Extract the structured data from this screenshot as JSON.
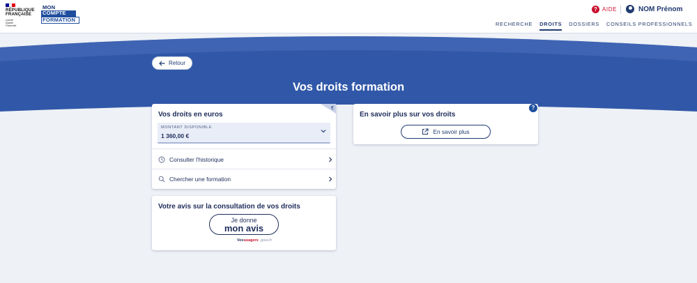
{
  "header": {
    "republique": [
      "RÉPUBLIQUE",
      "FRANÇAISE"
    ],
    "motto": [
      "Liberté",
      "Égalité",
      "Fraternité"
    ],
    "mcf": [
      "MON",
      "COMPTE",
      "FORMATION"
    ],
    "help_label": "AIDE",
    "user_name": "NOM Prénom",
    "nav": [
      {
        "label": "RECHERCHE",
        "active": false
      },
      {
        "label": "DROITS",
        "active": true
      },
      {
        "label": "DOSSIERS",
        "active": false
      },
      {
        "label": "CONSEILS PROFESSIONNELS",
        "active": false
      }
    ]
  },
  "banner": {
    "back_label": "Retour",
    "title": "Vos droits formation"
  },
  "rights_card": {
    "title": "Vos droits en euros",
    "amount_label": "MONTANT DISPONIBLE",
    "amount_value": "1 360,00 €",
    "links": [
      {
        "label": "Consulter l'historique",
        "icon": "history-icon"
      },
      {
        "label": "Chercher une formation",
        "icon": "search-icon"
      }
    ]
  },
  "info_card": {
    "title": "En savoir plus sur vos droits",
    "button_label": "En savoir plus"
  },
  "avis_card": {
    "title": "Votre avis sur la consultation de vos droits",
    "button_small": "Je donne",
    "button_big": "mon avis",
    "brand_a": "Vox",
    "brand_b": "usagers",
    "brand_c": ".gouv.fr"
  },
  "colors": {
    "primary": "#1f3a70",
    "banner": "#3158a8",
    "accent_red": "#c8102e",
    "background": "#eef1f6"
  }
}
